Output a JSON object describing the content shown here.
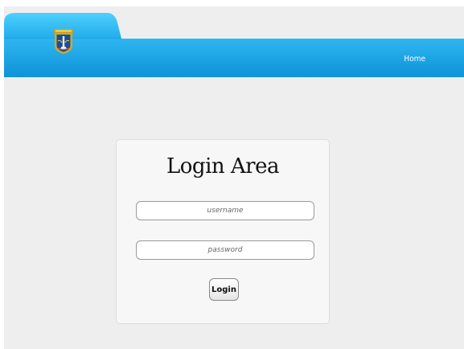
{
  "header": {
    "nav": {
      "home_label": "Home"
    },
    "colors": {
      "header_blue": "#1aa6ea",
      "tab_blue": "#3cc0f5",
      "page_background": "#eeeeee"
    },
    "logo_icon": "coat-of-arms-icon"
  },
  "login": {
    "title": "Login Area",
    "username_placeholder": "username",
    "password_placeholder": "password",
    "button_label": "Login"
  }
}
